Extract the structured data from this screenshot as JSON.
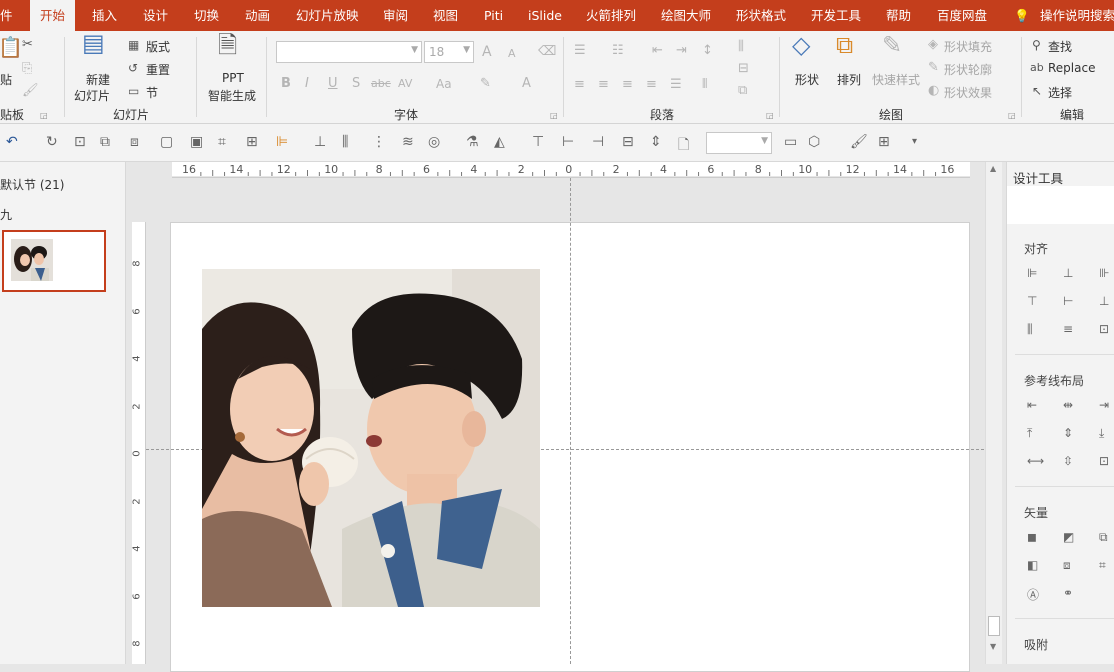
{
  "tabs": {
    "file": "件",
    "home": "开始",
    "insert": "插入",
    "design": "设计",
    "transitions": "切换",
    "animations": "动画",
    "slideshow": "幻灯片放映",
    "review": "审阅",
    "view": "视图",
    "piti": "Piti",
    "islide": "iSlide",
    "arrows": "火箭排列",
    "drawing_master": "绘图大师",
    "shape_format": "形状格式",
    "developer": "开发工具",
    "help": "帮助",
    "baidu": "百度网盘",
    "tell_me": "操作说明搜索"
  },
  "ribbon": {
    "clipboard": {
      "paste": "贴",
      "label": "贴板"
    },
    "slides": {
      "new_slide_line1": "新建",
      "new_slide_line2": "幻灯片",
      "layout": "版式",
      "reset": "重置",
      "section": "节",
      "label": "幻灯片"
    },
    "ppt_gen": {
      "line1": "PPT",
      "line2": "智能生成"
    },
    "font": {
      "size": "18",
      "label": "字体",
      "bold": "B",
      "italic": "I",
      "underline": "U",
      "shadow": "S",
      "strike": "abc",
      "spacing": "AV",
      "case": "Aa",
      "color": "A",
      "grow": "A",
      "shrink": "A"
    },
    "paragraph": {
      "label": "段落"
    },
    "drawing": {
      "shape": "形状",
      "arrange": "排列",
      "quick_styles": "快速样式",
      "fill": "形状填充",
      "outline": "形状轮廓",
      "effect": "形状效果",
      "label": "绘图"
    },
    "editing": {
      "find": "查找",
      "replace": "Replace",
      "select": "选择",
      "label": "编辑"
    }
  },
  "thumbnails": {
    "section_name": "默认节 (21)",
    "slide_number": "九"
  },
  "ruler": {
    "h_labels": [
      "16",
      "14",
      "12",
      "10",
      "8",
      "6",
      "4",
      "2",
      "0",
      "2",
      "4",
      "6",
      "8",
      "10",
      "12",
      "14",
      "16"
    ],
    "v_labels": [
      "8",
      "6",
      "4",
      "2",
      "0",
      "2",
      "4",
      "6",
      "8"
    ]
  },
  "panel": {
    "title": "设计工具",
    "align": "对齐",
    "guides": "参考线布局",
    "vector": "矢量",
    "snap": "吸附"
  },
  "colors": {
    "accent": "#c43e1c",
    "ribbon_bg": "#f3f3f3"
  }
}
